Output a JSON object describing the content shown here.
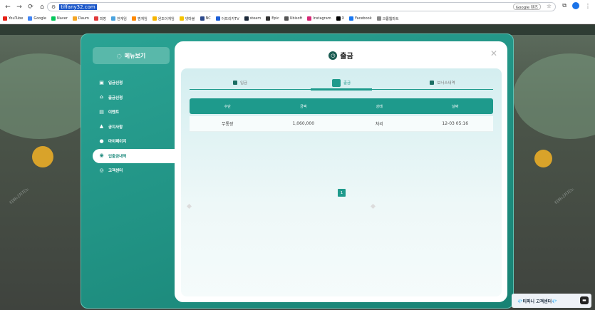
{
  "browser": {
    "url": "tiffany32.com",
    "lens_label": "Google 렌즈",
    "bookmarks": [
      {
        "label": "YouTube",
        "color": "#e62117"
      },
      {
        "label": "Google",
        "color": "#4285f4"
      },
      {
        "label": "Naver",
        "color": "#03c75a"
      },
      {
        "label": "Daum",
        "color": "#f5a623"
      },
      {
        "label": "피망",
        "color": "#e03a3a"
      },
      {
        "label": "한게임",
        "color": "#4aa3df"
      },
      {
        "label": "엠게임",
        "color": "#ff8a00"
      },
      {
        "label": "윈조이게임",
        "color": "#f7b500"
      },
      {
        "label": "넷마블",
        "color": "#f5c400"
      },
      {
        "label": "NC",
        "color": "#2d4a8c"
      },
      {
        "label": "아프리카TV",
        "color": "#1d5fd6"
      },
      {
        "label": "steam",
        "color": "#1b2838"
      },
      {
        "label": "Epic",
        "color": "#333333"
      },
      {
        "label": "Ubisoft",
        "color": "#555555"
      },
      {
        "label": "Instagram",
        "color": "#d62976"
      },
      {
        "label": "X",
        "color": "#000000"
      },
      {
        "label": "Facebook",
        "color": "#1877f2"
      },
      {
        "label": "크롬웹마트",
        "color": "#888888"
      }
    ]
  },
  "sidebar": {
    "menu_title": "메뉴보기",
    "items": [
      {
        "label": "입금신청",
        "icon": "deposit-icon",
        "active": false
      },
      {
        "label": "출금신청",
        "icon": "bank-icon",
        "active": false
      },
      {
        "label": "이벤트",
        "icon": "gift-icon",
        "active": false
      },
      {
        "label": "공지사항",
        "icon": "bell-icon",
        "active": false
      },
      {
        "label": "마이페이지",
        "icon": "user-icon",
        "active": false
      },
      {
        "label": "입출금내역",
        "icon": "history-icon",
        "active": true
      },
      {
        "label": "고객센터",
        "icon": "headset-icon",
        "active": false
      }
    ]
  },
  "panel": {
    "title": "출금",
    "close_label": "✕",
    "tabs": [
      {
        "label": "입금",
        "active": false
      },
      {
        "label": "출금",
        "active": true
      },
      {
        "label": "보너스내역",
        "active": false
      }
    ],
    "columns": [
      "수단",
      "금액",
      "상태",
      "날짜"
    ],
    "rows": [
      [
        "무통장",
        "1,060,000",
        "처리",
        "12-03 05:16"
      ]
    ],
    "page": "1"
  },
  "support": {
    "label": "💎티파니 고객센터💎",
    "icon": "chat-icon"
  },
  "watermark": "티파니카지노"
}
